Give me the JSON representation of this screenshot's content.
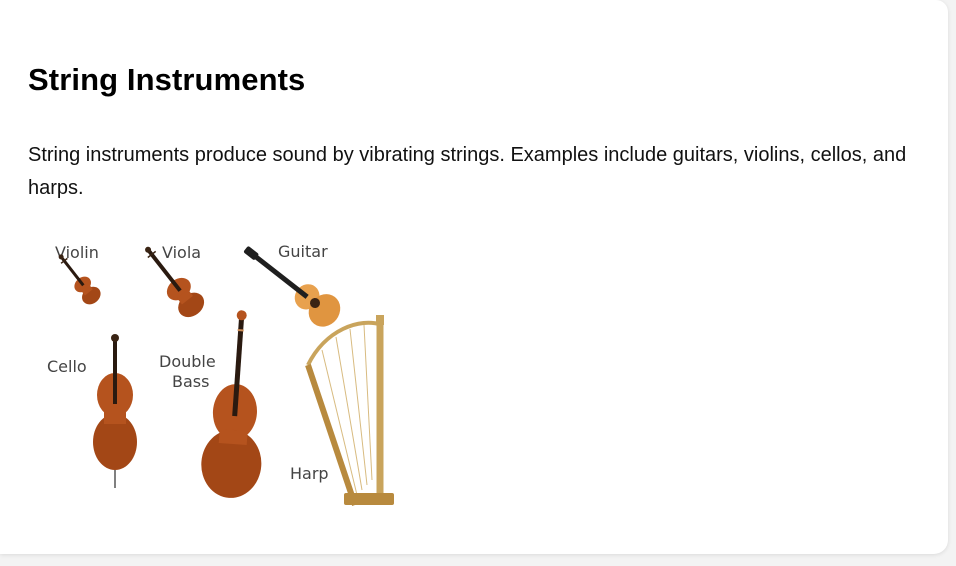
{
  "card": {
    "title": "String Instruments",
    "description": "String instruments produce sound by vibrating strings. Examples include guitars, violins, cellos, and harps."
  },
  "figure": {
    "labels": {
      "violin": "Violin",
      "viola": "Viola",
      "guitar": "Guitar",
      "cello": "Cello",
      "double_bass_line1": "Double",
      "double_bass_line2": "Bass",
      "harp": "Harp"
    },
    "colors": {
      "wood": "#b5531e",
      "wood_dark": "#7a2f10",
      "guitar_top": "#e8a14e",
      "harp_gold": "#c9a45c"
    }
  }
}
